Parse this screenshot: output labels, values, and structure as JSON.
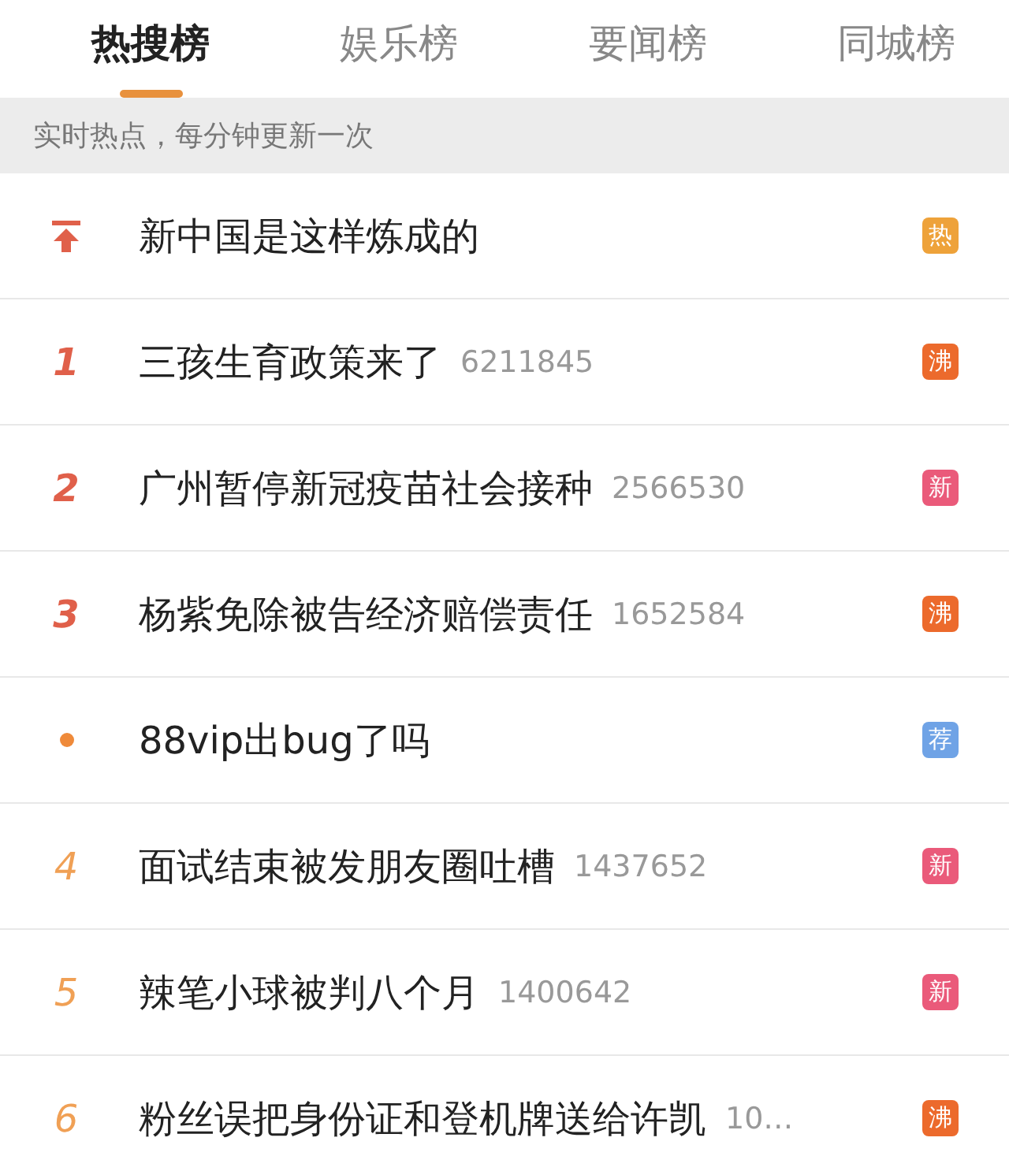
{
  "tabs": [
    {
      "label": "热搜榜",
      "selected": true
    },
    {
      "label": "娱乐榜",
      "selected": false
    },
    {
      "label": "要闻榜",
      "selected": false
    },
    {
      "label": "同城榜",
      "selected": false
    }
  ],
  "notice": "实时热点，每分钟更新一次",
  "items": [
    {
      "kind": "pinned",
      "title": "新中国是这样炼成的",
      "badge": "热",
      "color": "#eea23a"
    },
    {
      "kind": "top",
      "rank": "1",
      "title": "三孩生育政策来了",
      "count": "6211845",
      "badge": "沸",
      "color": "#ec6a2c"
    },
    {
      "kind": "top",
      "rank": "2",
      "title": "广州暂停新冠疫苗社会接种",
      "count": "2566530",
      "badge": "新",
      "color": "#ea5a7a"
    },
    {
      "kind": "top",
      "rank": "3",
      "title": "杨紫免除被告经济赔偿责任",
      "count": "1652584",
      "badge": "沸",
      "color": "#ec6a2c"
    },
    {
      "kind": "promoted",
      "title": "88vip出bug了吗",
      "badge": "荐",
      "color": "#6fa3e6"
    },
    {
      "kind": "normal",
      "rank": "4",
      "title": "面试结束被发朋友圈吐槽",
      "count": "1437652",
      "badge": "新",
      "color": "#ea5a7a"
    },
    {
      "kind": "normal",
      "rank": "5",
      "title": "辣笔小球被判八个月",
      "count": "1400642",
      "badge": "新",
      "color": "#ea5a7a"
    },
    {
      "kind": "normal",
      "rank": "6",
      "title": "粉丝误把身份证和登机牌送给许凯",
      "count": "10…",
      "badge": "沸",
      "color": "#ec6a2c"
    }
  ]
}
